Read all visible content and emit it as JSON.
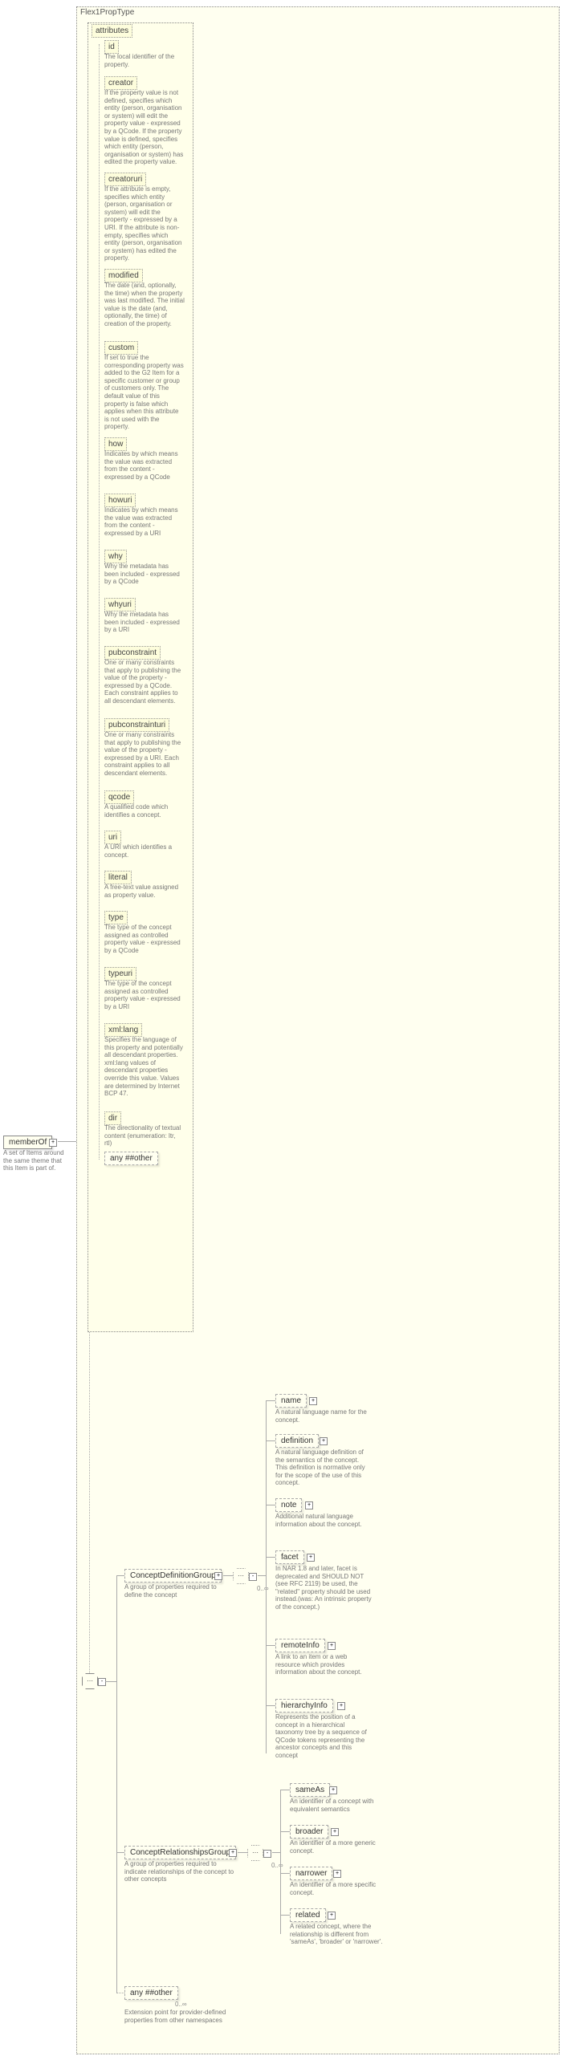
{
  "root": {
    "flex1PropType": "Flex1PropType",
    "attributesLabel": "attributes"
  },
  "memberOf": {
    "label": "memberOf",
    "desc": "A set of Items around the same theme that this Item is part of."
  },
  "attrs": [
    {
      "name": "id",
      "desc": "The local identifier of the property."
    },
    {
      "name": "creator",
      "desc": "If the property value is not defined, specifies which entity (person, organisation or system) will edit the property value - expressed by a QCode. If the property value is defined, specifies which entity (person, organisation or system) has edited the property value."
    },
    {
      "name": "creatoruri",
      "desc": "If the attribute is empty, specifies which entity (person, organisation or system) will edit the property - expressed by a URI. If the attribute is non-empty, specifies which entity (person, organisation or system) has edited the property."
    },
    {
      "name": "modified",
      "desc": "The date (and, optionally, the time) when the property was last modified. The initial value is the date (and, optionally, the time) of creation of the property."
    },
    {
      "name": "custom",
      "desc": "If set to true the corresponding property was added to the G2 Item for a specific customer or group of customers only. The default value of this property is false which applies when this attribute is not used with the property."
    },
    {
      "name": "how",
      "desc": "Indicates by which means the value was extracted from the content - expressed by a QCode"
    },
    {
      "name": "howuri",
      "desc": "Indicates by which means the value was extracted from the content - expressed by a URI"
    },
    {
      "name": "why",
      "desc": "Why the metadata has been included - expressed by a QCode"
    },
    {
      "name": "whyuri",
      "desc": "Why the metadata has been included - expressed by a URI"
    },
    {
      "name": "pubconstraint",
      "desc": "One or many constraints that apply to publishing the value of the property - expressed by a QCode. Each constraint applies to all descendant elements."
    },
    {
      "name": "pubconstrainturi",
      "desc": "One or many constraints that apply to publishing the value of the property - expressed by a URI. Each constraint applies to all descendant elements."
    },
    {
      "name": "qcode",
      "desc": "A qualified code which identifies a concept."
    },
    {
      "name": "uri",
      "desc": "A URI which identifies a concept."
    },
    {
      "name": "literal",
      "desc": "A free-text value assigned as property value."
    },
    {
      "name": "type",
      "desc": "The type of the concept assigned as controlled property value - expressed by a QCode"
    },
    {
      "name": "typeuri",
      "desc": "The type of the concept assigned as controlled property value - expressed by a URI"
    },
    {
      "name": "xml:lang",
      "desc": "Specifies the language of this property and potentially all descendant properties. xml:lang values of descendant properties override this value. Values are determined by Internet BCP 47."
    },
    {
      "name": "dir",
      "desc": "The directionality of textual content (enumeration: ltr, rtl)"
    }
  ],
  "anyOther": "any ##other",
  "groups": {
    "definition": {
      "label": "ConceptDefinitionGroup",
      "desc": "A group of properties required to define the concept"
    },
    "relationships": {
      "label": "ConceptRelationshipsGroup",
      "desc": "A group of properties required to indicate relationships of the concept to other concepts"
    },
    "extension": {
      "label": "any ##other",
      "desc": "Extension point for provider-defined properties from other namespaces"
    }
  },
  "defChildren": [
    {
      "name": "name",
      "desc": "A natural language name for the concept."
    },
    {
      "name": "definition",
      "desc": "A natural language definition of the semantics of the concept. This definition is normative only for the scope of the use of this concept."
    },
    {
      "name": "note",
      "desc": "Additional natural language information about the concept."
    },
    {
      "name": "facet",
      "desc": "In NAR 1.8 and later, facet is deprecated and SHOULD NOT (see RFC 2119) be used, the \"related\" property should be used instead.(was: An intrinsic property of the concept.)"
    },
    {
      "name": "remoteInfo",
      "desc": "A link to an item or a web resource which provides information about the concept."
    },
    {
      "name": "hierarchyInfo",
      "desc": "Represents the position of a concept in a hierarchical taxonomy tree by a sequence of QCode tokens representing the ancestor concepts and this concept"
    }
  ],
  "relChildren": [
    {
      "name": "sameAs",
      "desc": "An identifier of a concept with equivalent semantics"
    },
    {
      "name": "broader",
      "desc": "An identifier of a more generic concept."
    },
    {
      "name": "narrower",
      "desc": "An identifier of a more specific concept."
    },
    {
      "name": "related",
      "desc": "A related concept, where the relationship is different from 'sameAs', 'broader' or 'narrower'."
    }
  ],
  "cardinality": "0..∞"
}
